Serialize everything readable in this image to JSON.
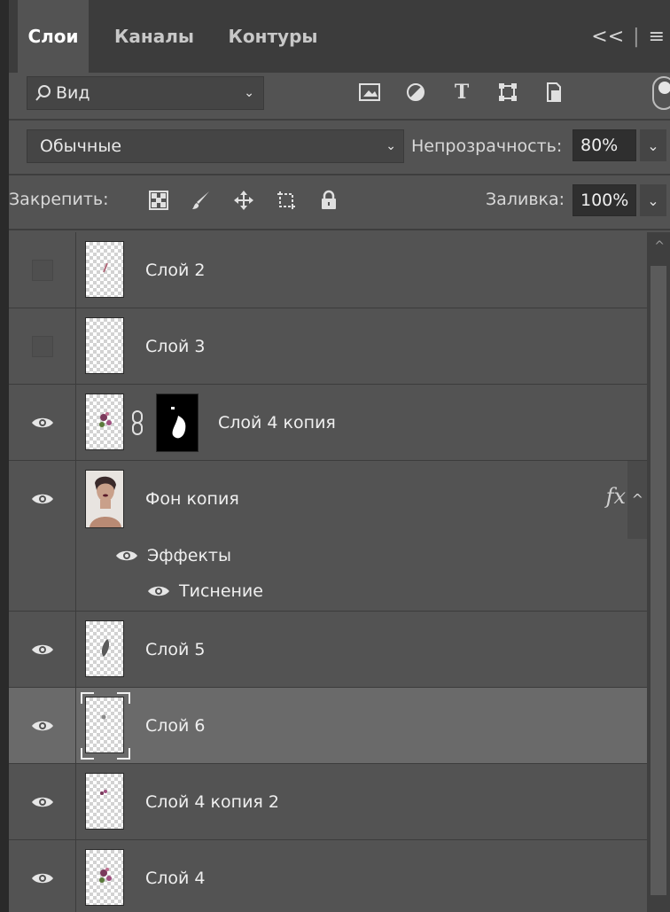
{
  "tabs": [
    {
      "label": "Слои"
    },
    {
      "label": "Каналы"
    },
    {
      "label": "Контуры"
    }
  ],
  "tabs_right": {
    "collapse": "<<",
    "separator": "|",
    "menu": "≡"
  },
  "filter": {
    "value": "Вид"
  },
  "blend": {
    "mode": "Обычные",
    "opacity_label": "Непрозрачность:",
    "opacity_value": "80%"
  },
  "lock": {
    "label": "Закрепить:",
    "fill_label": "Заливка:",
    "fill_value": "100%"
  },
  "layers": [
    {
      "name": "Слой 2",
      "visible": false
    },
    {
      "name": "Слой 3",
      "visible": false
    },
    {
      "name": "Слой 4 копия",
      "visible": true,
      "has_mask": true
    },
    {
      "name": "Фон копия",
      "visible": true,
      "fx": "fx",
      "effects_label": "Эффекты",
      "effect": "Тиснение"
    },
    {
      "name": "Слой 5",
      "visible": true
    },
    {
      "name": "Слой 6",
      "visible": true,
      "selected": true
    },
    {
      "name": "Слой 4 копия 2",
      "visible": true
    },
    {
      "name": "Слой 4",
      "visible": true
    }
  ],
  "colors": {
    "panel_bg": "#535353",
    "tab_bar": "#3c3c3c",
    "selected_row": "#6a6a6a"
  }
}
